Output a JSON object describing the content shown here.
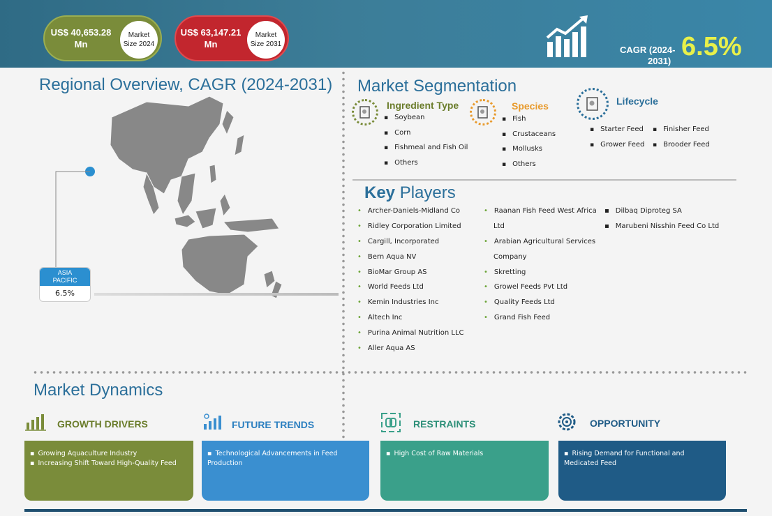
{
  "header": {
    "market_2024": {
      "value": "US$ 40,653.28 Mn",
      "label_line1": "Market",
      "label_line2": "Size 2024"
    },
    "market_2031": {
      "value": "US$ 63,147.21 Mn",
      "label_line1": "Market",
      "label_line2": "Size 2031"
    },
    "cagr_label_line1": "CAGR (2024-",
    "cagr_label_line2": "2031)",
    "cagr_value": "6.5%"
  },
  "regional": {
    "title": "Regional Overview, CAGR (2024-2031)",
    "region_name_line1": "ASIA",
    "region_name_line2": "PACIFIC",
    "region_value": "6.5%"
  },
  "segmentation": {
    "title": "Market Segmentation",
    "ingredient": {
      "title": "Ingredient Type",
      "items": [
        "Soybean",
        "Corn",
        "Fishmeal and Fish Oil",
        "Others"
      ]
    },
    "species": {
      "title": "Species",
      "items": [
        "Fish",
        "Crustaceans",
        "Mollusks",
        "Others"
      ]
    },
    "lifecycle": {
      "title": "Lifecycle",
      "items": [
        "Starter Feed",
        "Finisher Feed",
        "Grower Feed",
        "Brooder Feed"
      ]
    }
  },
  "key_players": {
    "title_bold": "Key",
    "title_rest": " Players",
    "col1": [
      "Archer-Daniels-Midland Co",
      "Ridley Corporation Limited",
      "Cargill, Incorporated",
      "Bern Aqua NV",
      "BioMar Group AS",
      "World Feeds Ltd",
      "Kemin Industries Inc",
      "Altech Inc",
      "Purina Animal Nutrition LLC",
      "Aller Aqua AS"
    ],
    "col2": [
      "Raanan Fish Feed West Africa",
      "Ltd",
      "Arabian Agricultural Services",
      "Company",
      "Skretting",
      "Growel Feeds Pvt Ltd",
      "Quality Feeds Ltd",
      "Grand Fish Feed"
    ],
    "col2_bullets": [
      true,
      false,
      true,
      false,
      true,
      true,
      true,
      true
    ],
    "col3": [
      "Dilbaq Diproteg SA",
      "Marubeni Nisshin Feed Co Ltd"
    ]
  },
  "dynamics": {
    "title": "Market Dynamics",
    "drivers": {
      "title": "GROWTH DRIVERS",
      "color": "#7a8c3a",
      "items": [
        "Growing Aquaculture Industry",
        "Increasing Shift Toward High-Quality Feed"
      ]
    },
    "trends": {
      "title": "FUTURE TRENDS",
      "color": "#3a8fd0",
      "items": [
        "Technological Advancements in Feed Production"
      ]
    },
    "restraints": {
      "title": "RESTRAINTS",
      "color": "#3aa08a",
      "items": [
        "High Cost of Raw Materials"
      ]
    },
    "opportunity": {
      "title": "OPPORTUNITY",
      "color": "#1f5b86",
      "items": [
        "Rising Demand for Functional and Medicated Feed"
      ]
    }
  },
  "colors": {
    "accent_blue": "#2b6f9a",
    "green": "#6ba436",
    "orange": "#e89a2c",
    "header": "#3a7d98"
  },
  "icons": [
    "growth-chart-icon",
    "segment-doc-icon",
    "bar-chart-icon",
    "trend-icon",
    "restraint-chain-icon",
    "gear-target-icon"
  ]
}
